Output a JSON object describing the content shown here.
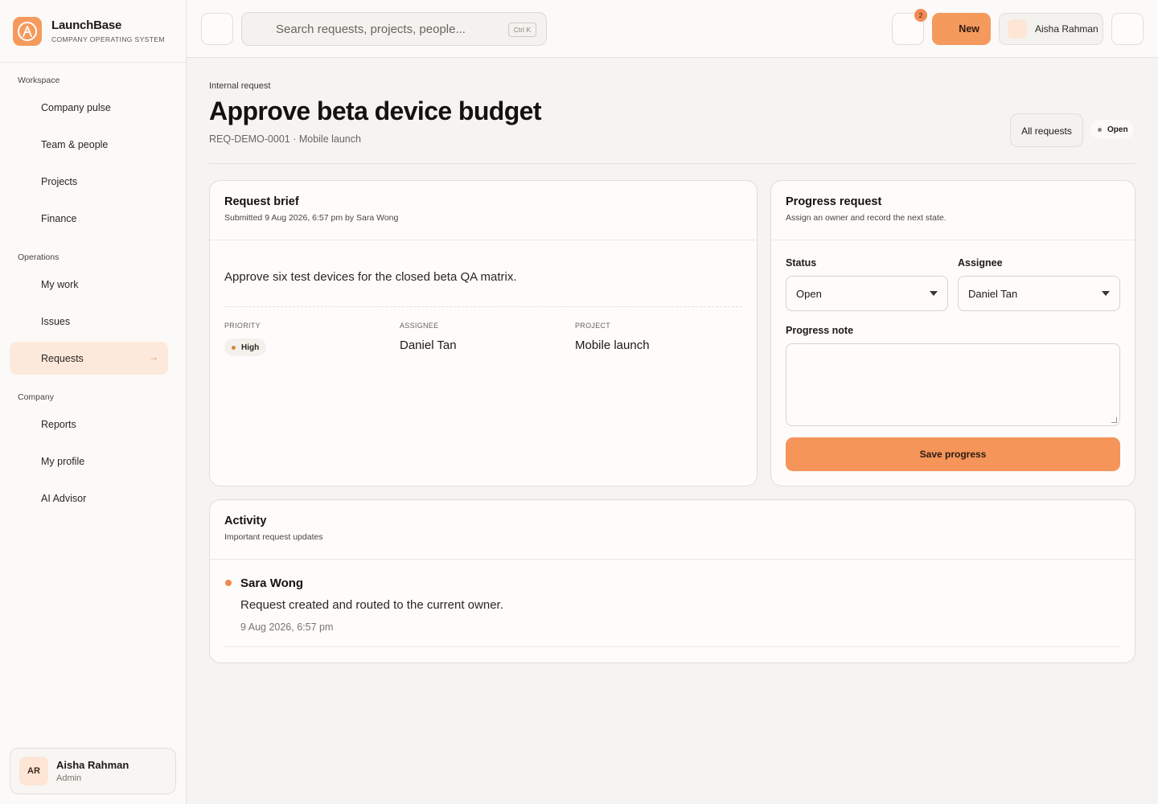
{
  "brand": {
    "name": "LaunchBase",
    "tagline": "COMPANY OPERATING SYSTEM"
  },
  "sidebar": {
    "sections": [
      {
        "label": "Workspace",
        "items": [
          {
            "label": "Company pulse"
          },
          {
            "label": "Team & people"
          },
          {
            "label": "Projects"
          },
          {
            "label": "Finance"
          }
        ]
      },
      {
        "label": "Operations",
        "items": [
          {
            "label": "My work"
          },
          {
            "label": "Issues"
          },
          {
            "label": "Requests",
            "active": true
          }
        ]
      },
      {
        "label": "Company",
        "items": [
          {
            "label": "Reports"
          },
          {
            "label": "My profile"
          },
          {
            "label": "AI Advisor"
          }
        ]
      }
    ],
    "active_arrow": "→",
    "user": {
      "initials": "AR",
      "name": "Aisha Rahman",
      "role": "Admin"
    }
  },
  "topbar": {
    "search_placeholder": "Search requests, projects, people...",
    "search_shortcut": "Ctrl K",
    "notification_count": "2",
    "new_label": "New",
    "user_name": "Aisha Rahman"
  },
  "page": {
    "eyebrow": "Internal request",
    "title": "Approve beta device budget",
    "subtitle": "REQ-DEMO-0001 · Mobile launch",
    "all_requests_label": "All requests",
    "status_label": "Open"
  },
  "brief": {
    "title": "Request brief",
    "submitted": "Submitted 9 Aug 2026, 6:57 pm by Sara Wong",
    "description": "Approve six test devices for the closed beta QA matrix.",
    "priority_label": "PRIORITY",
    "priority_value": "High",
    "assignee_label": "ASSIGNEE",
    "assignee_value": "Daniel Tan",
    "project_label": "PROJECT",
    "project_value": "Mobile launch"
  },
  "progress": {
    "title": "Progress request",
    "subtitle": "Assign an owner and record the next state.",
    "status_label": "Status",
    "status_value": "Open",
    "assignee_label": "Assignee",
    "assignee_value": "Daniel Tan",
    "note_label": "Progress note",
    "note_value": "",
    "save_label": "Save progress"
  },
  "activity": {
    "title": "Activity",
    "subtitle": "Important request updates",
    "entries": [
      {
        "author": "Sara Wong",
        "text": "Request created and routed to the current owner.",
        "time": "9 Aug 2026, 6:57 pm"
      }
    ]
  },
  "colors": {
    "accent": "#f59a5d",
    "active_nav_bg": "#fde9db",
    "priority_dot": "#d08a3a",
    "status_dot": "#8a837b"
  }
}
